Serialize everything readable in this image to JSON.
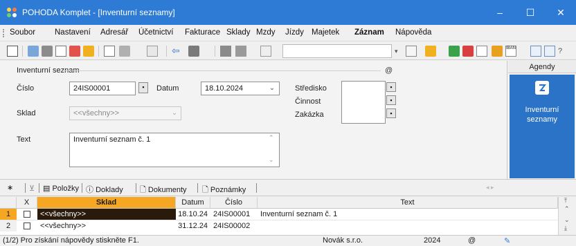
{
  "window": {
    "title": "POHODA Komplet - [Inventurní seznamy]",
    "minimize": "–",
    "maximize": "☐",
    "close": "✕"
  },
  "menu": [
    "Soubor",
    "Nastavení",
    "Adresář",
    "Účetnictví",
    "Fakturace",
    "Sklady",
    "Mzdy",
    "Jízdy",
    "Majetek",
    "Záznam",
    "Nápověda"
  ],
  "form": {
    "section_title": "Inventurní seznam",
    "at_symbol": "@",
    "cislo_label": "Číslo",
    "cislo_value": "24IS00001",
    "datum_label": "Datum",
    "datum_value": "18.10.2024",
    "sklad_label": "Sklad",
    "sklad_value": "<<všechny>>",
    "text_label": "Text",
    "text_value": "Inventurní seznam č. 1",
    "stredisko_label": "Středisko",
    "cinnost_label": "Činnost",
    "zakazka_label": "Zakázka"
  },
  "agendy": {
    "header": "Agendy",
    "item_label": "Inventurní seznamy"
  },
  "tabs": {
    "star": "∗",
    "items": [
      "Položky",
      "Doklady",
      "Dokumenty",
      "Poznámky"
    ]
  },
  "table": {
    "columns": [
      "X",
      "Sklad",
      "Datum",
      "Číslo",
      "Text"
    ],
    "rows": [
      {
        "num": "1",
        "sklad": "<<všechny>>",
        "datum": "18.10.24",
        "cislo": "24IS00001",
        "text": "Inventurní seznam č. 1"
      },
      {
        "num": "2",
        "sklad": "<<všechny>>",
        "datum": "31.12.24",
        "cislo": "24IS00002",
        "text": ""
      }
    ]
  },
  "status": {
    "hint": "(1/2) Pro získání nápovědy stiskněte F1.",
    "company": "Novák s.r.o.",
    "year": "2024",
    "at": "@"
  },
  "colors": {
    "titlebar": "#2e7bd6",
    "agendy_panel": "#2a73c7",
    "sklad_header": "#f5a623",
    "selected_row": "#2a1a0c"
  }
}
